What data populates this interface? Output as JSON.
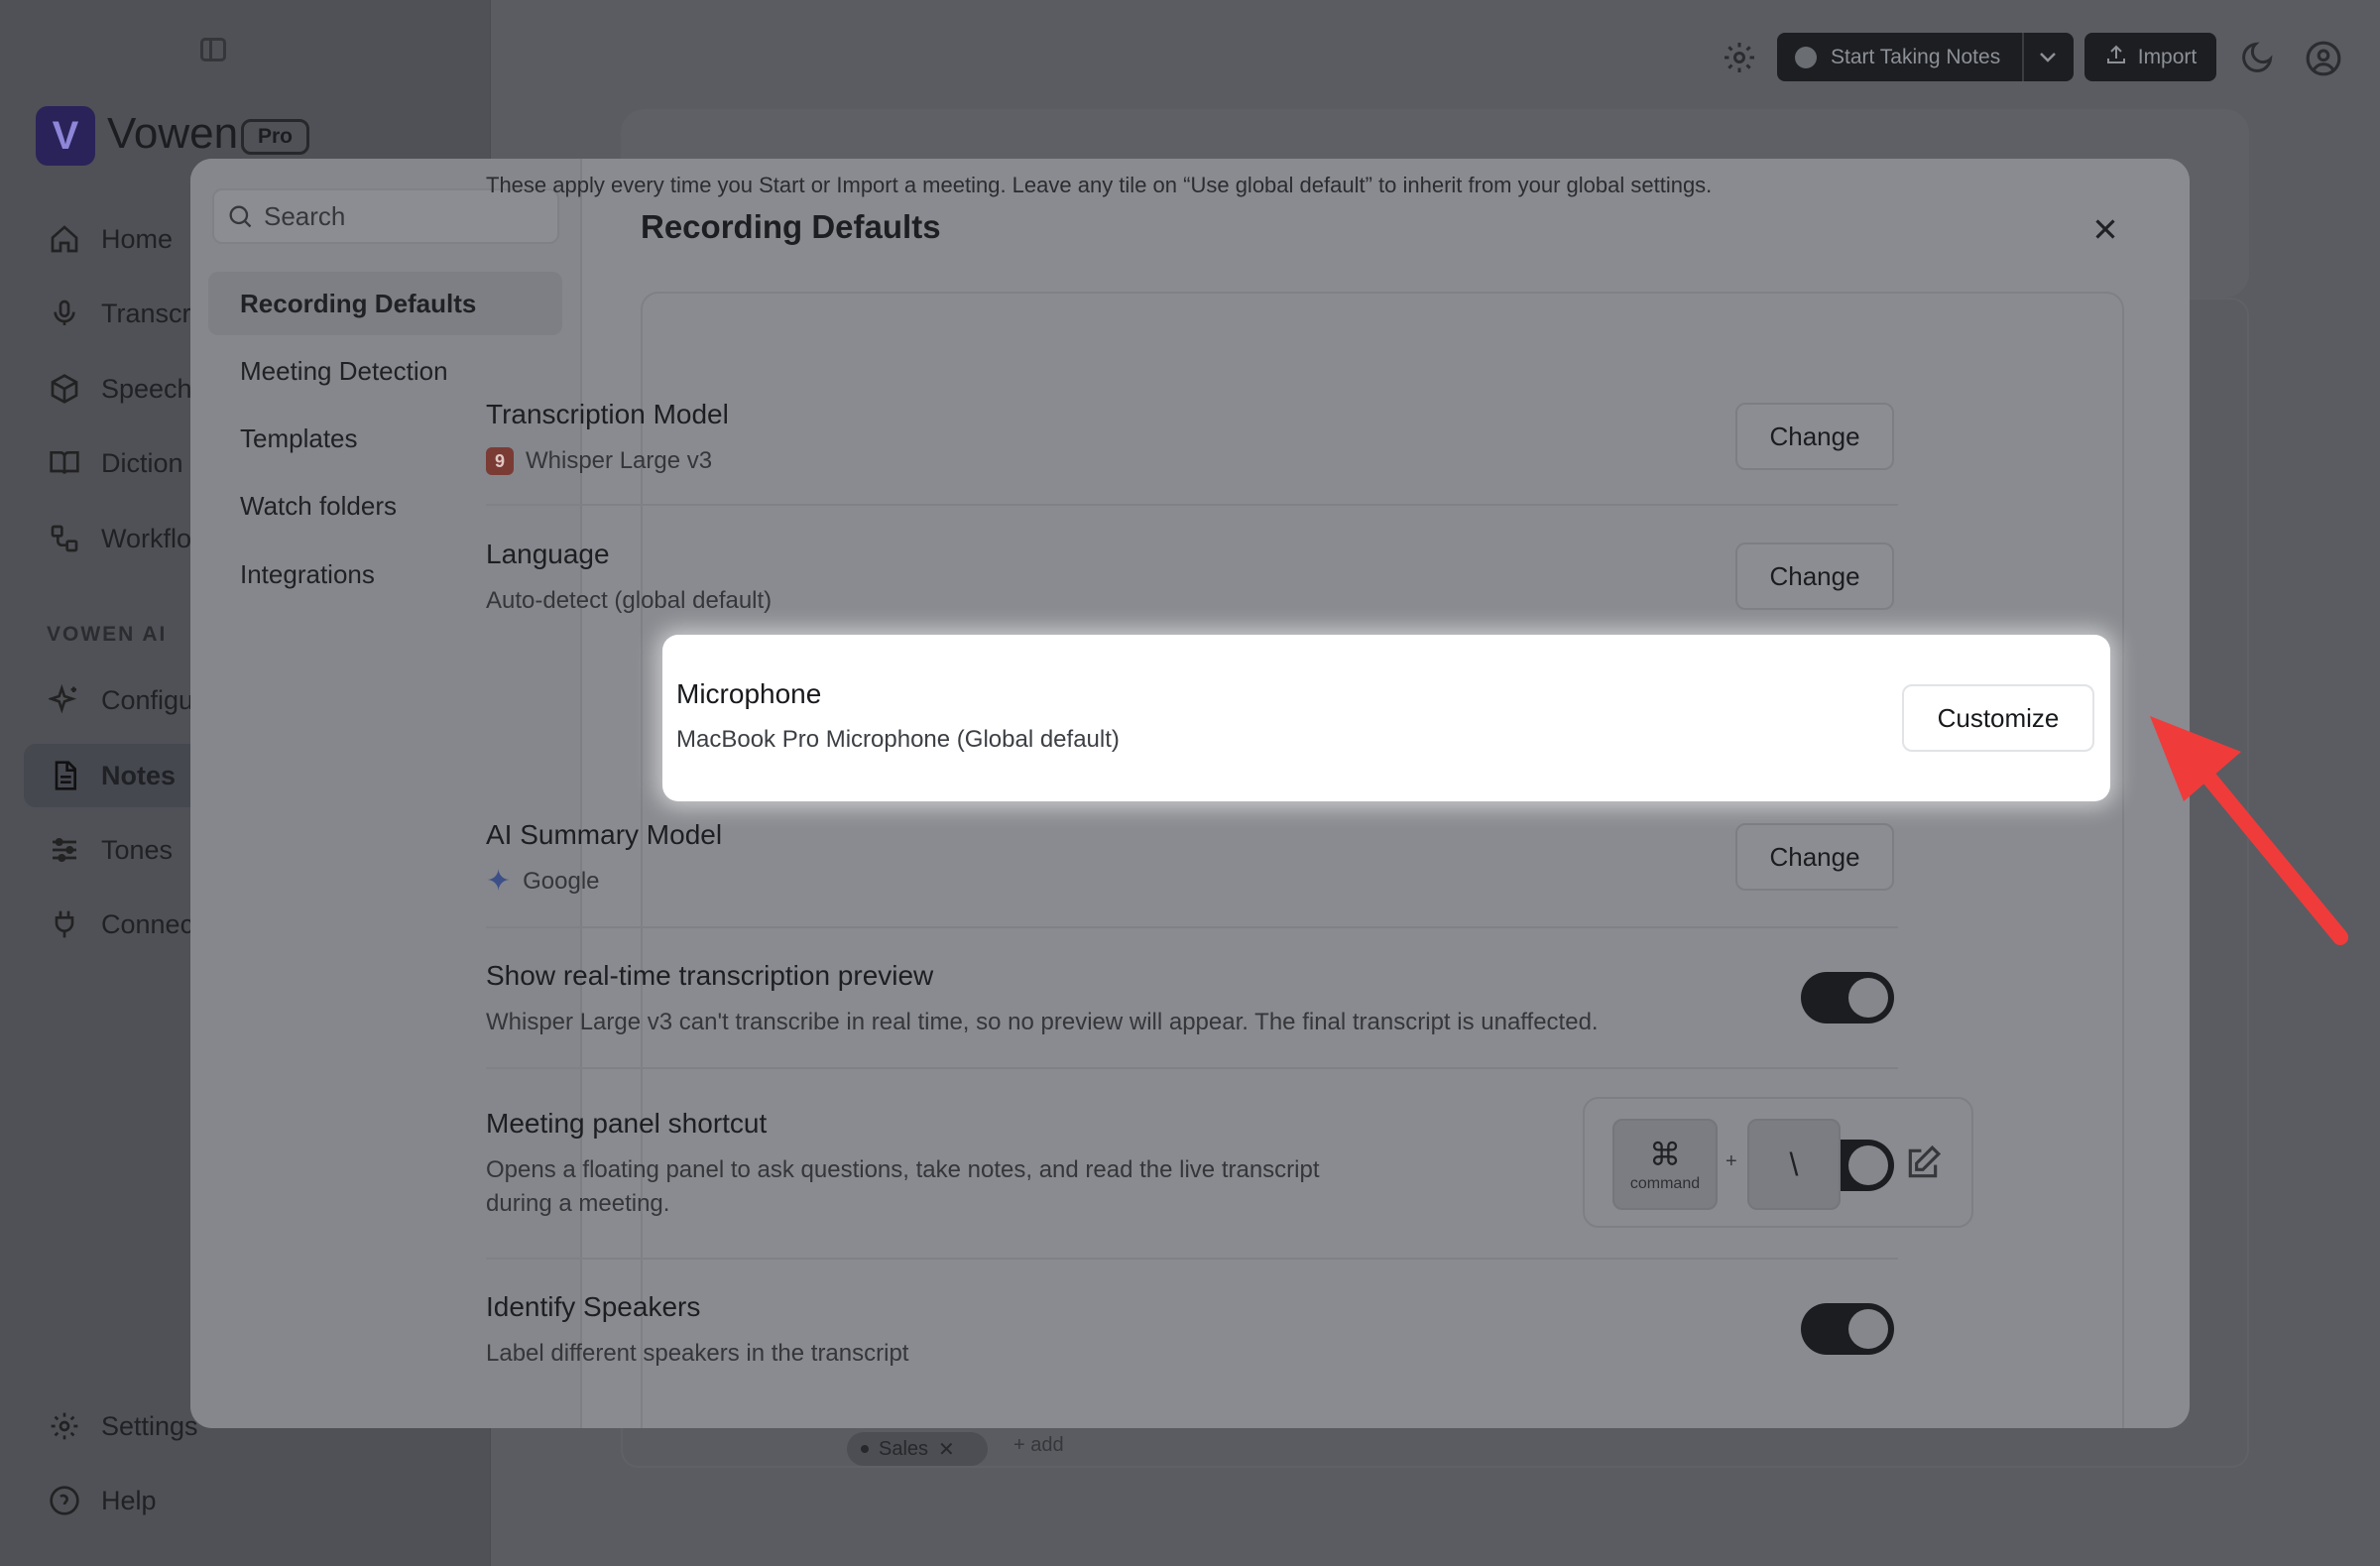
{
  "app": {
    "brand": "Vowen",
    "plan_badge": "Pro",
    "nav": [
      {
        "label": "Home",
        "icon": "home-icon"
      },
      {
        "label": "Transcri",
        "icon": "microphone-icon"
      },
      {
        "label": "Speech",
        "icon": "cube-icon"
      },
      {
        "label": "Diction",
        "icon": "book-icon"
      },
      {
        "label": "Workflo",
        "icon": "workflow-icon"
      },
      {
        "label": "Configu",
        "icon": "sparkles-icon"
      },
      {
        "label": "Notes",
        "icon": "document-icon"
      },
      {
        "label": "Tones",
        "icon": "sliders-icon"
      },
      {
        "label": "Connec",
        "icon": "plug-icon"
      },
      {
        "label": "Settings",
        "icon": "gear-icon"
      },
      {
        "label": "Help",
        "icon": "help-icon"
      }
    ],
    "section_label": "VOWEN AI",
    "header": {
      "start_label": "Start Taking Notes",
      "import_label": "Import"
    },
    "tag": {
      "label": "Sales",
      "add_label": "+ add"
    }
  },
  "modal": {
    "search_placeholder": "Search",
    "menu": [
      "Recording Defaults",
      "Meeting Detection",
      "Templates",
      "Watch folders",
      "Integrations"
    ],
    "title": "Recording Defaults",
    "intro": "These apply every time you Start or Import a meeting. Leave any tile on “Use global default” to inherit from your global settings.",
    "rows": {
      "transcription": {
        "title": "Transcription Model",
        "value": "Whisper Large v3",
        "badge": "9",
        "action": "Change"
      },
      "language": {
        "title": "Language",
        "value": "Auto-detect (global default)",
        "action": "Change"
      },
      "microphone": {
        "title": "Microphone",
        "value": "MacBook Pro Microphone (Global default)",
        "action": "Customize"
      },
      "summary": {
        "title": "AI Summary Model",
        "value": "Google",
        "action": "Change"
      },
      "preview": {
        "title": "Show real-time transcription preview",
        "value": "Whisper Large v3 can't transcribe in real time, so no preview will appear. The final transcript is unaffected.",
        "enabled": true
      },
      "shortcut": {
        "title": "Meeting panel shortcut",
        "value_line1": "Opens a floating panel to ask questions, take notes, and read the live transcript",
        "value_line2": "during a meeting.",
        "key1_symbol": "⌘",
        "key1_label": "command",
        "plus": "+",
        "key2": "\\",
        "enabled": true
      },
      "speakers": {
        "title": "Identify Speakers",
        "value": "Label different speakers in the transcript",
        "enabled": true
      }
    }
  },
  "colors": {
    "accent_arrow": "#f03b3b",
    "toggle_on": "#1b1d21"
  }
}
